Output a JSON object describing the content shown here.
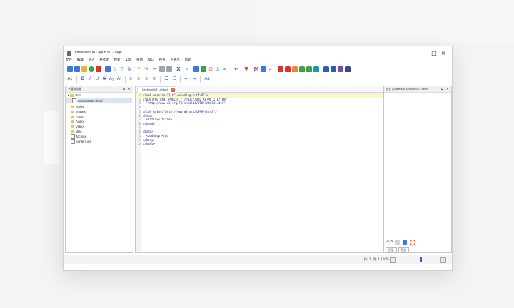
{
  "window": {
    "title": "untitled.epub - epub3.0 - Sigil",
    "controls": [
      "–",
      "□",
      "×"
    ]
  },
  "menu": [
    "文件",
    "编辑",
    "插入",
    "格式化",
    "搜索",
    "工具",
    "视图",
    "窗口",
    "检查",
    "检查术",
    "帮助"
  ],
  "toolbar_colors": {
    "blue": "#3b78d8",
    "green": "#3aa346",
    "orange": "#e88a2c",
    "red": "#d9342b",
    "purple": "#7a4bb3",
    "teal": "#1c9aa3"
  },
  "left_pane": {
    "title": "书籍浏览器",
    "items": [
      {
        "label": "Text",
        "type": "folder",
        "expanded": true
      },
      {
        "label": "Section0001.xhtml",
        "type": "file",
        "selected": true
      },
      {
        "label": "Styles",
        "type": "folder"
      },
      {
        "label": "Images",
        "type": "folder"
      },
      {
        "label": "Fonts",
        "type": "folder"
      },
      {
        "label": "Audio",
        "type": "folder"
      },
      {
        "label": "Video",
        "type": "folder"
      },
      {
        "label": "Misc",
        "type": "folder"
      },
      {
        "label": "toc.ncx",
        "type": "file"
      },
      {
        "label": "content.opf",
        "type": "file"
      }
    ]
  },
  "editor": {
    "tab_label": "Section0001.xhtml",
    "lines": [
      {
        "n": "1",
        "text": "<?xml version=\"1.0\" encoding=\"utf-8\"?>",
        "highlight": true
      },
      {
        "n": "2",
        "text": "<!DOCTYPE html PUBLIC \"-//W3C//DTD XHTML 1.1//EN\""
      },
      {
        "n": "3",
        "text": "  \"http://www.w3.org/TR/xhtml11/DTD/xhtml11.dtd\">"
      },
      {
        "n": "4",
        "text": ""
      },
      {
        "n": "5",
        "text": "<html xmlns=\"http://www.w3.org/1999/xhtml\">"
      },
      {
        "n": "6",
        "text": "<head>"
      },
      {
        "n": "7",
        "text": "  <title></title>"
      },
      {
        "n": "8",
        "text": "</head>"
      },
      {
        "n": "9",
        "text": ""
      },
      {
        "n": "10",
        "text": "<body>"
      },
      {
        "n": "11",
        "text": "  <p>&nbsp;</p>"
      },
      {
        "n": "12",
        "text": "</body>"
      },
      {
        "n": "13",
        "text": "</html>"
      }
    ]
  },
  "right_pane": {
    "title": "预览 (QtWebKit) Section0001.xhtml",
    "tabs": [
      "目录",
      "预览"
    ]
  },
  "status": {
    "position": "行: 1, 列: 1  100%",
    "zoom_percent": 55
  }
}
